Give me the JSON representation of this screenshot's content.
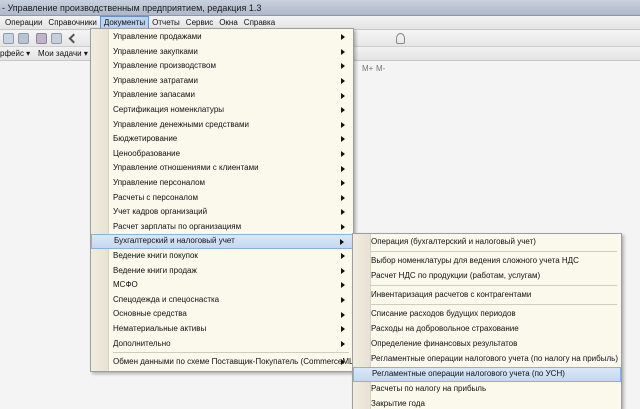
{
  "window": {
    "title": "- Управление производственным предприятием, редакция 1.3"
  },
  "menubar": [
    {
      "label": "Операции"
    },
    {
      "label": "Справочники"
    },
    {
      "label": "Документы"
    },
    {
      "label": "Отчеты"
    },
    {
      "label": "Сервис"
    },
    {
      "label": "Окна"
    },
    {
      "label": "Справка"
    }
  ],
  "toolbar": {
    "calc_buttons": [
      "M+",
      "M-"
    ]
  },
  "panel_bar": {
    "interface_label": "рфейс ▾",
    "tasks_label": "Мои задачи ▾"
  },
  "documents_menu": {
    "items": [
      {
        "label": "Управление продажами",
        "submenu": true
      },
      {
        "label": "Управление закупками",
        "submenu": true
      },
      {
        "label": "Управление производством",
        "submenu": true
      },
      {
        "label": "Управление затратами",
        "submenu": true
      },
      {
        "label": "Управление запасами",
        "submenu": true
      },
      {
        "label": "Сертификация номенклатуры",
        "submenu": true
      },
      {
        "label": "Управление денежными средствами",
        "submenu": true
      },
      {
        "label": "Бюджетирование",
        "submenu": true
      },
      {
        "label": "Ценообразование",
        "submenu": true
      },
      {
        "label": "Управление отношениями с клиентами",
        "submenu": true
      },
      {
        "label": "Управление персоналом",
        "submenu": true
      },
      {
        "label": "Расчеты с персоналом",
        "submenu": true
      },
      {
        "label": "Учет кадров организаций",
        "submenu": true
      },
      {
        "label": "Расчет зарплаты по организациям",
        "submenu": true
      },
      {
        "label": "Бухгалтерский и налоговый учет",
        "submenu": true
      },
      {
        "label": "Ведение книги покупок",
        "submenu": true
      },
      {
        "label": "Ведение книги продаж",
        "submenu": true
      },
      {
        "label": "МСФО",
        "submenu": true
      },
      {
        "label": "Спецодежда и спецоснастка",
        "submenu": true
      },
      {
        "label": "Основные средства",
        "submenu": true
      },
      {
        "label": "Нематериальные активы",
        "submenu": true
      },
      {
        "label": "Дополнительно",
        "submenu": true
      },
      {
        "label": "Обмен данными по схеме Поставщик-Покупатель (CommerceML)",
        "submenu": true
      }
    ]
  },
  "accounting_submenu": {
    "items": [
      {
        "label": "Операция (бухгалтерский и налоговый учет)"
      },
      {
        "label": "Выбор номенклатуры для ведения сложного учета НДС"
      },
      {
        "label": "Расчет НДС по продукции (работам, услугам)"
      },
      {
        "label": "Инвентаризация расчетов с контрагентами"
      },
      {
        "label": "Списание расходов будущих периодов"
      },
      {
        "label": "Расходы на добровольное страхование"
      },
      {
        "label": "Определение финансовых результатов"
      },
      {
        "label": "Регламентные операции налогового учета (по налогу на прибыль)"
      },
      {
        "label": "Регламентные операции налогового учета (по УСН)"
      },
      {
        "label": "Расчеты по налогу на прибыль"
      },
      {
        "label": "Закрытие года"
      }
    ]
  }
}
